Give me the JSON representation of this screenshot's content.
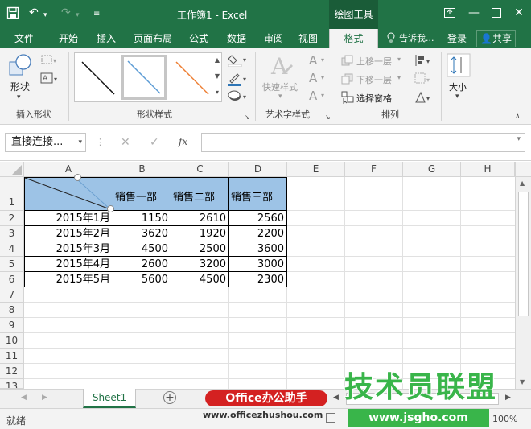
{
  "title_bar": {
    "document_title": "工作簿1 - Excel",
    "context_tab_title": "绘图工具"
  },
  "tabs": [
    "文件",
    "开始",
    "插入",
    "页面布局",
    "公式",
    "数据",
    "审阅",
    "视图"
  ],
  "active_tab": "格式",
  "tell_me": "告诉我...",
  "login": "登录",
  "share": "共享",
  "ribbon": {
    "insert_shapes": {
      "shape_label": "形状",
      "group_label": "插入形状"
    },
    "shape_styles": {
      "group_label": "形状样式"
    },
    "wordart": {
      "quick_styles": "快速样式",
      "group_label": "艺术字样式"
    },
    "arrange": {
      "bring_forward": "上移一层",
      "send_backward": "下移一层",
      "selection_pane": "选择窗格",
      "group_label": "排列"
    },
    "size": {
      "label": "大小"
    }
  },
  "formula_bar": {
    "name_box": "直接连接...",
    "fx": "fx"
  },
  "sheet": {
    "columns": [
      "A",
      "B",
      "C",
      "D",
      "E",
      "F",
      "G",
      "H"
    ],
    "row_numbers": [
      "1",
      "2",
      "3",
      "4",
      "5",
      "6",
      "7",
      "8",
      "9",
      "10",
      "11",
      "12",
      "13"
    ],
    "header_row": [
      "",
      "销售一部",
      "销售二部",
      "销售三部"
    ],
    "data_rows": [
      [
        "2015年1月",
        "1150",
        "2610",
        "2560"
      ],
      [
        "2015年2月",
        "3620",
        "1920",
        "2200"
      ],
      [
        "2015年3月",
        "4500",
        "2500",
        "3600"
      ],
      [
        "2015年4月",
        "2600",
        "3200",
        "3000"
      ],
      [
        "2015年5月",
        "5600",
        "4500",
        "2300"
      ]
    ],
    "header_fill": "#9dc3e6"
  },
  "sheet_tabs": [
    "Sheet1"
  ],
  "status": {
    "ready": "就绪",
    "zoom": "100%"
  },
  "watermarks": {
    "office_badge": "Office办公助手",
    "office_url": "www.officezhushou.com",
    "jsgho_brand": "技术员联盟",
    "jsgho_url": "www.jsgho.com"
  },
  "colors": {
    "excel_green": "#217346",
    "watermark_red": "#d42121",
    "watermark_green": "#39b54a"
  }
}
